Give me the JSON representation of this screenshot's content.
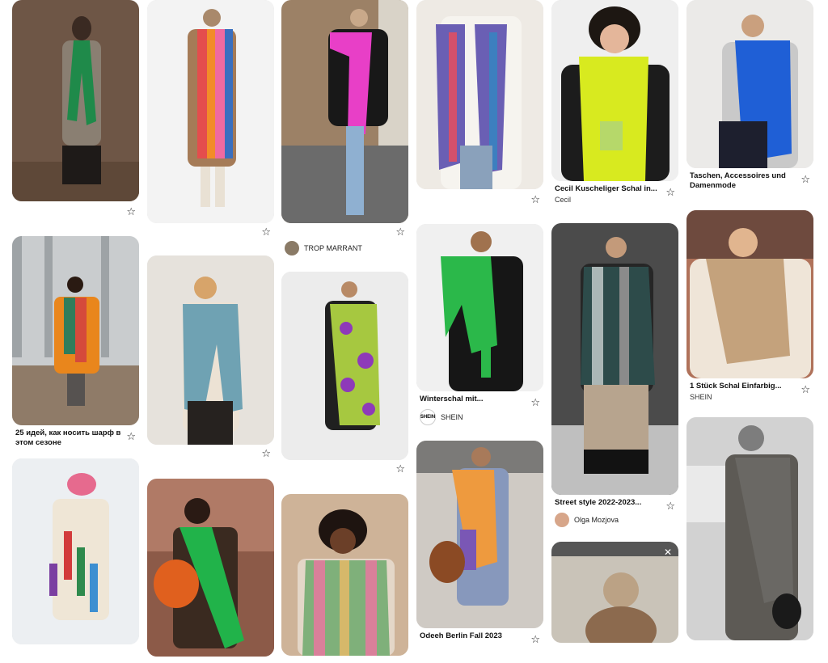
{
  "colors": {
    "star": "#222222",
    "card_bg": "#dddddd"
  },
  "pins": [
    {
      "id": "p1",
      "title": "",
      "subtitle": "",
      "creator": ""
    },
    {
      "id": "p2",
      "title": "25 идей, как носить шарф в этом сезоне",
      "subtitle": "",
      "creator": ""
    },
    {
      "id": "p3",
      "title": "",
      "subtitle": "",
      "creator": ""
    },
    {
      "id": "p4",
      "title": "",
      "subtitle": "",
      "creator": ""
    },
    {
      "id": "p5",
      "title": "",
      "subtitle": "",
      "creator": ""
    },
    {
      "id": "p6",
      "title": "",
      "subtitle": "",
      "creator": ""
    },
    {
      "id": "p7",
      "title": "",
      "subtitle": "",
      "creator": "TROP MARRANT"
    },
    {
      "id": "p8",
      "title": "",
      "subtitle": "",
      "creator": ""
    },
    {
      "id": "p9",
      "title": "",
      "subtitle": "",
      "creator": ""
    },
    {
      "id": "p10",
      "title": "",
      "subtitle": "",
      "creator": ""
    },
    {
      "id": "p11",
      "title": "Winterschal mit...",
      "subtitle": "",
      "creator": "SHEIN"
    },
    {
      "id": "p12",
      "title": "Odeeh Berlin Fall 2023",
      "subtitle": "",
      "creator": ""
    },
    {
      "id": "p13",
      "title": "Cecil Kuscheliger Schal in...",
      "subtitle": "Cecil",
      "creator": ""
    },
    {
      "id": "p14",
      "title": "Street style 2022-2023...",
      "subtitle": "",
      "creator": "Olga Mozjova"
    },
    {
      "id": "p15",
      "title": "",
      "subtitle": "",
      "creator": ""
    },
    {
      "id": "p16",
      "title": "Taschen, Accessoires und Damenmode",
      "subtitle": "",
      "creator": ""
    },
    {
      "id": "p17",
      "title": "1 Stück Schal Einfarbig...",
      "subtitle": "SHEIN",
      "creator": ""
    },
    {
      "id": "p18",
      "title": "",
      "subtitle": "",
      "creator": ""
    }
  ],
  "icons": {
    "save": "star-outline-icon",
    "close": "close-icon"
  },
  "glyphs": {
    "star": "☆",
    "close": "✕",
    "shein_logo": "SHEIN"
  }
}
